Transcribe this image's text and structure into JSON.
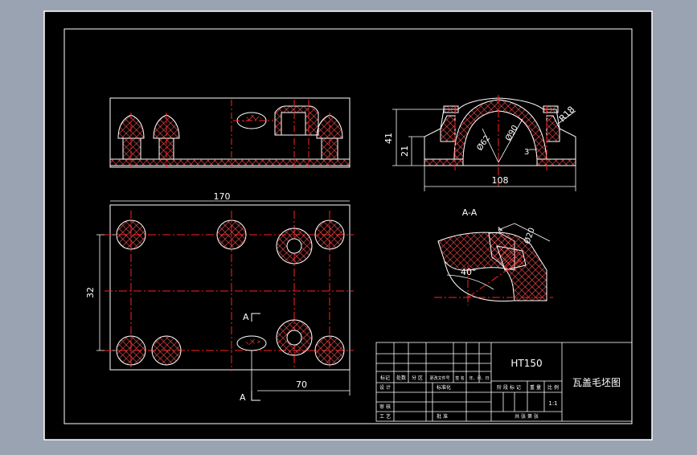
{
  "colors": {
    "background_gray": "#9aa3b1",
    "drawing_black": "#000000",
    "line_white": "#ffffff",
    "center_red": "#ff2020",
    "hatch_red": "#ff5050"
  },
  "top_view": {
    "dimension_width": "170",
    "dimension_height": "32",
    "dimension_offset": "70",
    "section_label_top": "A",
    "section_label_bottom": "A"
  },
  "side_view": {
    "dim_height_total": "41",
    "dim_height_mid": "21",
    "dim_width": "108",
    "dim_radius": "R18",
    "dim_inner_dia": "Ø62",
    "dim_outer_dia": "Ø90",
    "dim_small": "3"
  },
  "section_view": {
    "title": "A-A",
    "angle": "40°",
    "hole_dia": "Ø20",
    "hole_small": "4"
  },
  "title_block": {
    "material": "HT150",
    "drawing_name": "瓦盖毛坯图",
    "scale": "1:1",
    "row_labels": {
      "marking": "标记",
      "count": "处数",
      "zone": "分 区",
      "change_doc": "更改文件号",
      "signature": "签 名",
      "date": "年、月、日",
      "designer": "设 计",
      "standardize": "标准化",
      "stage_mark": "阶 段 标 记",
      "weight": "重 量",
      "scale_label": "比 例",
      "checker": "审 核",
      "process": "工 艺",
      "approve": "批 准",
      "sheets": "共   张   第   张"
    }
  }
}
